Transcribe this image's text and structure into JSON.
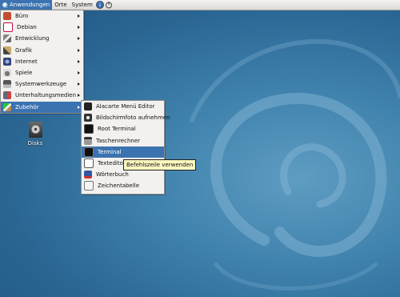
{
  "panel": {
    "menus": [
      "Anwendungen",
      "Orte",
      "System"
    ]
  },
  "main_menu": {
    "items": [
      {
        "label": "Büro",
        "icon": "office-icon"
      },
      {
        "label": "Debian",
        "icon": "debian-swirl-icon"
      },
      {
        "label": "Entwicklung",
        "icon": "development-icon"
      },
      {
        "label": "Grafik",
        "icon": "graphics-icon"
      },
      {
        "label": "Internet",
        "icon": "globe-icon"
      },
      {
        "label": "Spiele",
        "icon": "gamepad-icon"
      },
      {
        "label": "Systemwerkzeuge",
        "icon": "system-tools-icon"
      },
      {
        "label": "Unterhaltungsmedien",
        "icon": "multimedia-icon"
      },
      {
        "label": "Zubehör",
        "icon": "accessories-icon"
      }
    ],
    "selected": "Zubehör"
  },
  "sub_menu": {
    "items": [
      {
        "label": "Alacarte Menü Editor",
        "icon": "menu-editor-icon"
      },
      {
        "label": "Bildschirmfoto aufnehmen",
        "icon": "camera-icon"
      },
      {
        "label": "Root Terminal",
        "icon": "root-terminal-icon"
      },
      {
        "label": "Taschenrechner",
        "icon": "calculator-icon"
      },
      {
        "label": "Terminal",
        "icon": "terminal-icon"
      },
      {
        "label": "Texteditor",
        "icon": "text-editor-icon"
      },
      {
        "label": "Wörterbuch",
        "icon": "dictionary-icon"
      },
      {
        "label": "Zeichentabelle",
        "icon": "character-map-icon"
      }
    ],
    "selected": "Terminal"
  },
  "tooltip": {
    "text": "Befehlszeile verwenden"
  },
  "desktop": {
    "icons": [
      {
        "label": "Disks",
        "icon": "disk-drive-icon"
      }
    ]
  },
  "colors": {
    "selection": "#3b73b1",
    "desktop": "#2f6f9b",
    "menu_bg": "#f2f1ef",
    "tooltip_bg": "#fbf7c0"
  }
}
